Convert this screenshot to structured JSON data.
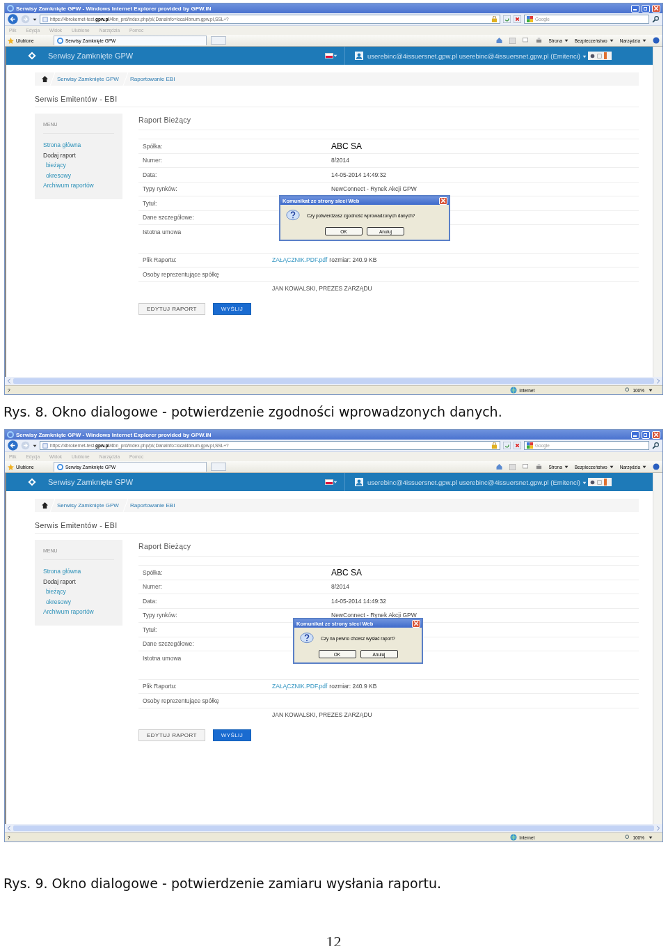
{
  "figures": [
    {
      "browser": {
        "title": "Serwisy Zamknięte GPW - Windows Internet Explorer provided by GPW.IN",
        "address": "https://4brokernet-test.**gpw.pl**/4bn_prd/index.php/pl/,DanaInfo=local4bnum.gpw.pl,SSL+?",
        "search_placeholder": "Google",
        "menu": [
          "Plik",
          "Edycja",
          "Widok",
          "Ulubione",
          "Narzędzia",
          "Pomoc"
        ],
        "favorites": "Ulubione",
        "tab": "Serwisy Zamknięte GPW",
        "commands": [
          "Strona",
          "Bezpieczeństwo",
          "Narzędzia"
        ],
        "status_text": "?",
        "zone": "Internet",
        "zoom": "100%"
      },
      "site": {
        "brand": "Serwisy Zamknięte GPW",
        "user": "userebinc@4issuersnet.gpw.pl userebinc@4issuersnet.gpw.pl (Emitenci)",
        "breadcrumb": [
          "Serwisy Zamknięte GPW",
          "Raportowanie EBI"
        ],
        "section_title": "Serwis Emitentów - EBI",
        "sidebar": {
          "heading": "MENU",
          "items": [
            {
              "label": "Strona główna",
              "kind": "link"
            },
            {
              "label": "Dodaj raport",
              "kind": "label",
              "children": [
                {
                  "label": "bieżący",
                  "kind": "link"
                },
                {
                  "label": "okresowy",
                  "kind": "link"
                }
              ]
            },
            {
              "label": "Archiwum raportów",
              "kind": "link"
            }
          ]
        },
        "report": {
          "title": "Raport Bieżący",
          "fields": [
            {
              "label": "Spółka:",
              "value": "ABC SA",
              "kind": "large"
            },
            {
              "label": "Numer:",
              "value": "8/2014",
              "kind": "normal"
            },
            {
              "label": "Data:",
              "value": "14-05-2014 14:49:32",
              "kind": "normal"
            },
            {
              "label": "Typy rynków:",
              "value": "NewConnect - Rynek Akcji GPW",
              "kind": "normal"
            },
            {
              "label": "Tytuł:"
            },
            {
              "label": "Dane szczegółowe:"
            },
            {
              "label": "Istotna umowa"
            }
          ],
          "attachment": {
            "label": "Plik Raportu:",
            "link": "ZAŁĄCZNIK.PDF.pdf",
            "size": "rozmiar: 240.9 KB"
          },
          "representatives": {
            "label": "Osoby reprezentujące spółkę",
            "value": "JAN KOWALSKI, PREZES ZARZĄDU"
          },
          "buttons": [
            {
              "label": "EDYTUJ RAPORT",
              "kind": "secondary"
            },
            {
              "label": "WYŚLIJ",
              "kind": "primary"
            }
          ]
        }
      },
      "dialog": {
        "title": "Komunikat ze strony sieci Web",
        "message": "Czy potwierdzasz zgodność wprowadzonych danych?",
        "buttons": [
          "OK",
          "Anuluj"
        ]
      },
      "caption": "Rys. 8. Okno dialogowe - potwierdzenie zgodności wprowadzonych danych."
    },
    {
      "browser": {
        "title": "Serwisy Zamknięte GPW - Windows Internet Explorer provided by GPW.IN",
        "address": "https://4brokernet-test.**gpw.pl**/4bn_prd/index.php/pl/,DanaInfo=local4bnum.gpw.pl,SSL+?",
        "search_placeholder": "Google",
        "menu": [
          "Plik",
          "Edycja",
          "Widok",
          "Ulubione",
          "Narzędzia",
          "Pomoc"
        ],
        "favorites": "Ulubione",
        "tab": "Serwisy Zamknięte GPW",
        "commands": [
          "Strona",
          "Bezpieczeństwo",
          "Narzędzia"
        ],
        "status_text": "?",
        "zone": "Internet",
        "zoom": "100%"
      },
      "site": {
        "brand": "Serwisy Zamknięte GPW",
        "user": "userebinc@4issuersnet.gpw.pl userebinc@4issuersnet.gpw.pl (Emitenci)",
        "breadcrumb": [
          "Serwisy Zamknięte GPW",
          "Raportowanie EBI"
        ],
        "section_title": "Serwis Emitentów - EBI",
        "sidebar": {
          "heading": "MENU",
          "items": [
            {
              "label": "Strona główna",
              "kind": "link"
            },
            {
              "label": "Dodaj raport",
              "kind": "label",
              "children": [
                {
                  "label": "bieżący",
                  "kind": "link"
                },
                {
                  "label": "okresowy",
                  "kind": "link"
                }
              ]
            },
            {
              "label": "Archiwum raportów",
              "kind": "link"
            }
          ]
        },
        "report": {
          "title": "Raport Bieżący",
          "fields": [
            {
              "label": "Spółka:",
              "value": "ABC SA",
              "kind": "large"
            },
            {
              "label": "Numer:",
              "value": "8/2014",
              "kind": "normal"
            },
            {
              "label": "Data:",
              "value": "14-05-2014 14:49:32",
              "kind": "normal"
            },
            {
              "label": "Typy rynków:",
              "value": "NewConnect - Rynek Akcji GPW",
              "kind": "normal"
            },
            {
              "label": "Tytuł:"
            },
            {
              "label": "Dane szczegółowe:"
            },
            {
              "label": "Istotna umowa"
            }
          ],
          "attachment": {
            "label": "Plik Raportu:",
            "link": "ZAŁĄCZNIK.PDF.pdf",
            "size": "rozmiar: 240.9 KB"
          },
          "representatives": {
            "label": "Osoby reprezentujące spółkę",
            "value": "JAN KOWALSKI, PREZES ZARZĄDU"
          },
          "buttons": [
            {
              "label": "EDYTUJ RAPORT",
              "kind": "secondary"
            },
            {
              "label": "WYŚLIJ",
              "kind": "primary"
            }
          ]
        }
      },
      "dialog": {
        "title": "Komunikat ze strony sieci Web",
        "message": "Czy na pewno chcesz wysłać raport?",
        "buttons": [
          "OK",
          "Anuluj"
        ]
      },
      "caption": "Rys. 9. Okno dialogowe - potwierdzenie zamiaru wysłania raportu."
    }
  ],
  "page_number": "12"
}
